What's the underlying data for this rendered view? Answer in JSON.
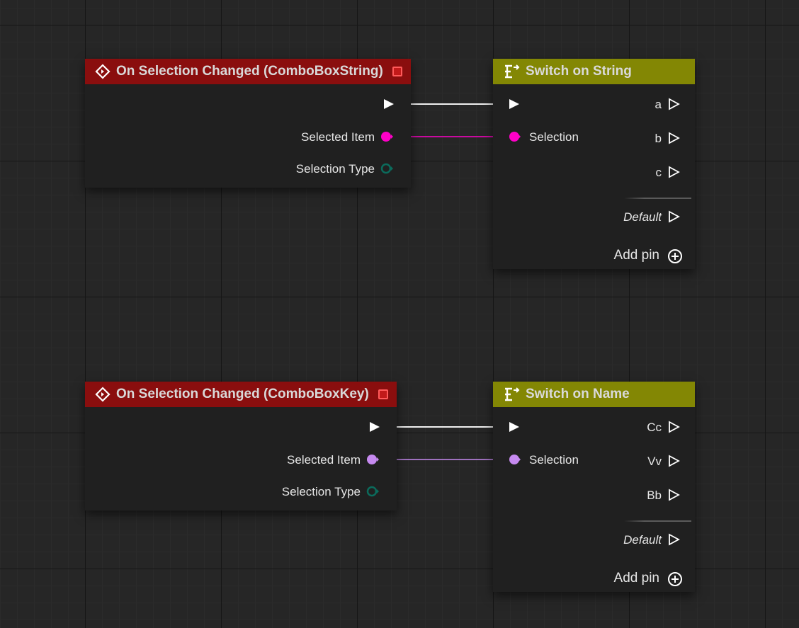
{
  "nodes": [
    {
      "title": "On Selection Changed (ComboBoxString)",
      "outputs": {
        "selected_item": "Selected Item",
        "selection_type": "Selection Type"
      },
      "colors": {
        "header": "#8a0e0e",
        "selected_item_pin": "#ff00c8",
        "selection_type_pin": "#0b6b5c"
      }
    },
    {
      "title": "Switch on String",
      "inputs": {
        "selection": "Selection"
      },
      "outputs": [
        "a",
        "b",
        "c"
      ],
      "default_label": "Default",
      "add_pin_label": "Add pin",
      "colors": {
        "header": "#838704"
      }
    },
    {
      "title": "On Selection Changed (ComboBoxKey)",
      "outputs": {
        "selected_item": "Selected Item",
        "selection_type": "Selection Type"
      },
      "colors": {
        "header": "#8a0e0e",
        "selected_item_pin": "#c68af0",
        "selection_type_pin": "#0b6b5c"
      }
    },
    {
      "title": "Switch on Name",
      "inputs": {
        "selection": "Selection"
      },
      "outputs": [
        "Cc",
        "Vv",
        "Bb"
      ],
      "default_label": "Default",
      "add_pin_label": "Add pin",
      "colors": {
        "header": "#838704"
      }
    }
  ]
}
